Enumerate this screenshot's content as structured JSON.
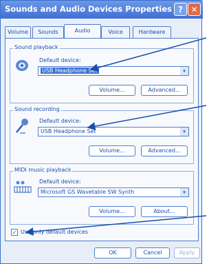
{
  "window": {
    "title": "Sounds and Audio Devices Properties",
    "help_glyph": "?",
    "close_glyph": "✕"
  },
  "tabs": [
    "Volume",
    "Sounds",
    "Audio",
    "Voice",
    "Hardware"
  ],
  "active_tab": "Audio",
  "playback": {
    "group_label": "Sound playback",
    "device_label": "Default device:",
    "device_value": "USB Headphone Set",
    "volume_button": "Volume...",
    "advanced_button": "Advanced..."
  },
  "recording": {
    "group_label": "Sound recording",
    "device_label": "Default device:",
    "device_value": "USB Headphone Set",
    "volume_button": "Volume...",
    "advanced_button": "Advanced..."
  },
  "midi": {
    "group_label": "MIDI music playback",
    "device_label": "Default device:",
    "device_value": "Microsoft GS Wavetable SW Synth",
    "volume_button": "Volume...",
    "about_button": "About..."
  },
  "default_only": {
    "label": "Use only default devices",
    "checked": true,
    "check_glyph": "✓"
  },
  "footer": {
    "ok": "OK",
    "cancel": "Cancel",
    "apply": "Apply"
  },
  "dropdown_glyph": "▾"
}
